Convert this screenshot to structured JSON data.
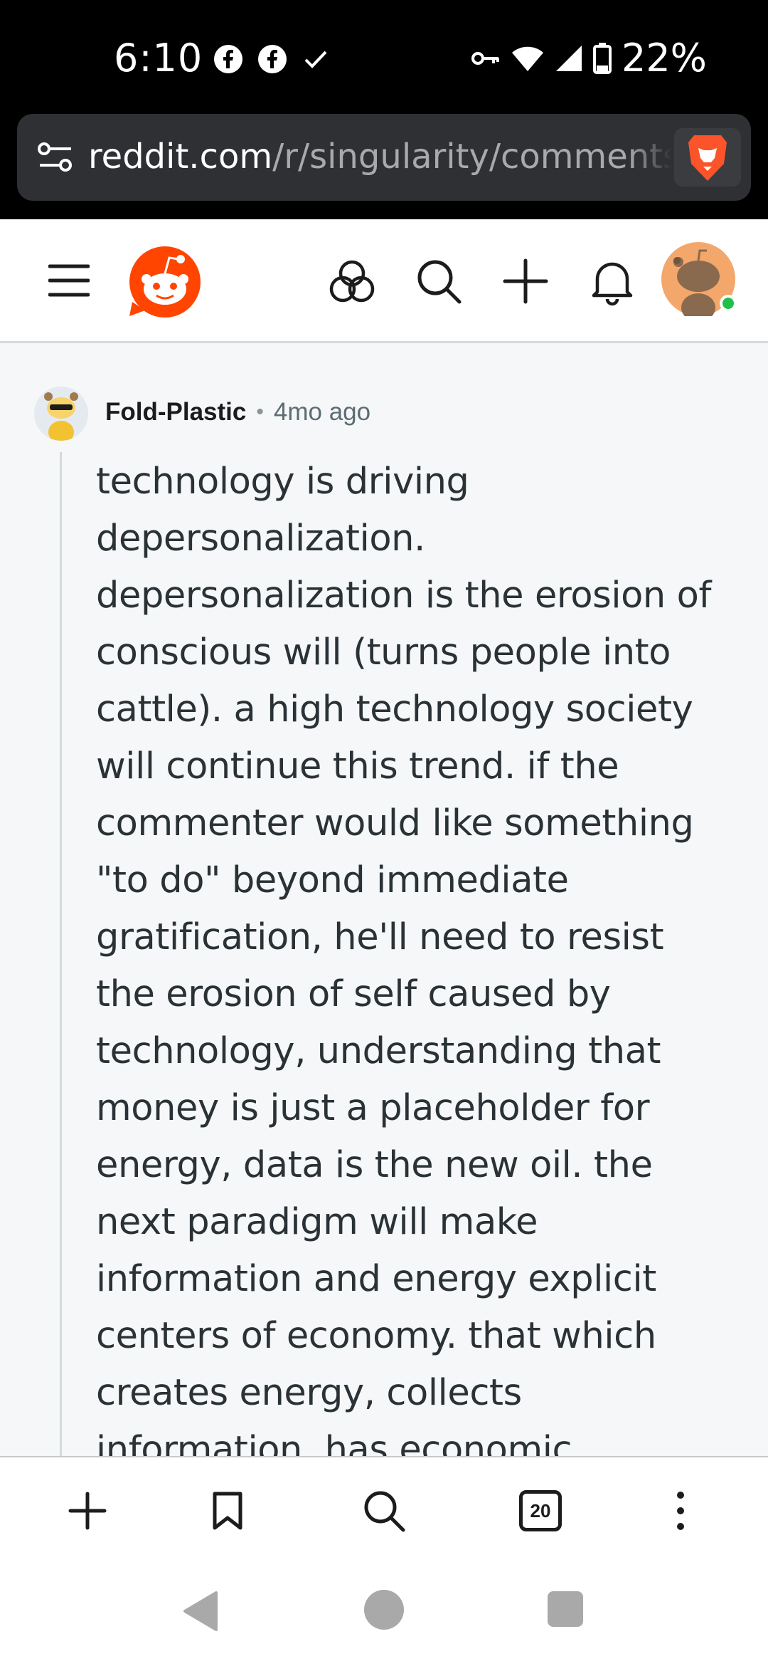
{
  "status_bar": {
    "time": "6:10",
    "battery": "22%",
    "left_icons": [
      "facebook-icon",
      "facebook-icon",
      "check-icon"
    ],
    "right_icons": [
      "vpn-key-icon",
      "wifi-icon",
      "signal-icon",
      "battery-icon"
    ]
  },
  "browser": {
    "url_domain": "reddit.com",
    "url_path": "/r/singularity/comments"
  },
  "reddit_header": {
    "icons": [
      "menu-icon",
      "reddit-logo",
      "answers-icon",
      "search-icon",
      "create-post-icon",
      "notifications-icon",
      "user-avatar"
    ]
  },
  "comment": {
    "author": "Fold-Plastic",
    "separator": "•",
    "time": "4mo ago",
    "body": "technology is driving depersonalization. depersonalization is the erosion of conscious will (turns people into cattle). a high technology society will continue this trend. if the commenter would like something \"to do\" beyond immediate gratification, he'll need to resist the erosion of self caused by technology, understanding that money is just a placeholder for energy, data is the new oil. the next paradigm will make information and energy explicit centers of economy. that which creates energy, collects information, has economic usefulness."
  },
  "bottom_toolbar": {
    "tab_count": "20",
    "icons": [
      "new-tab-icon",
      "bookmark-icon",
      "search-icon",
      "tabs-icon",
      "more-icon"
    ]
  },
  "colors": {
    "reddit_orange": "#ff4500",
    "online_green": "#1fbf4a",
    "page_background": "#f5f7f8"
  }
}
